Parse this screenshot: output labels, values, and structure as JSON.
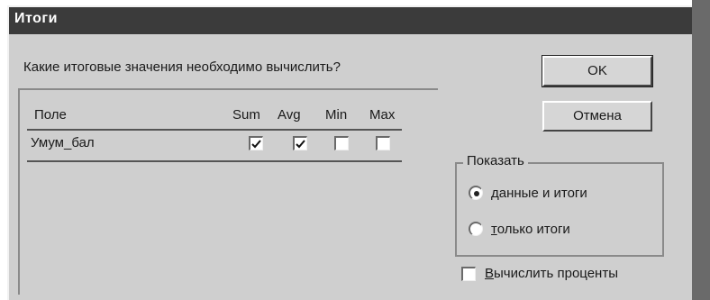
{
  "window": {
    "title": "Итоги"
  },
  "prompt": "Какие итоговые значения необходимо вычислить?",
  "table": {
    "headers": {
      "field": "Поле",
      "sum": "Sum",
      "avg": "Avg",
      "min": "Min",
      "max": "Max"
    },
    "rows": [
      {
        "field": "Умум_бал",
        "sum": true,
        "avg": true,
        "min": false,
        "max": false
      }
    ]
  },
  "buttons": {
    "ok": "OK",
    "cancel": "Отмена"
  },
  "show": {
    "legend": "Показать",
    "options": [
      {
        "first": "д",
        "rest": "анные и итоги",
        "selected": true
      },
      {
        "first": "т",
        "rest": "олько итоги",
        "selected": false
      }
    ]
  },
  "percent": {
    "first": "В",
    "rest": "ычислить проценты",
    "checked": false
  }
}
